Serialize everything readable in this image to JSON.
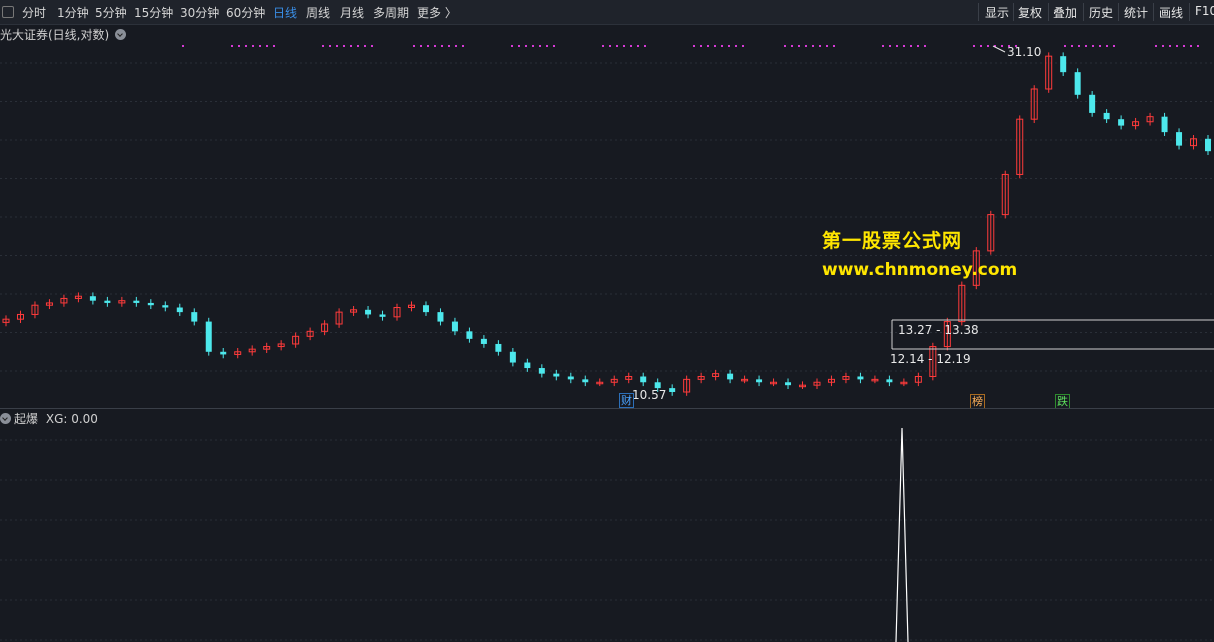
{
  "toolbar": {
    "tabs": [
      "分时",
      "1分钟",
      "5分钟",
      "15分钟",
      "30分钟",
      "60分钟",
      "日线",
      "周线",
      "月线",
      "多周期",
      "更多 〉"
    ],
    "active_tab": "日线",
    "right_buttons": [
      "显示",
      "复权",
      "叠加",
      "历史",
      "统计",
      "画线",
      "F10"
    ]
  },
  "chart": {
    "title": "光大证券(日线,对数)",
    "price_labels": {
      "high": "31.10",
      "low": "10.57",
      "range_upper": "13.27 - 13.38",
      "range_lower": "12.14 - 12.19"
    },
    "tags": {
      "cai": "财",
      "bang": "榜",
      "die": "跌"
    },
    "colors": {
      "up": "#ff3b3b",
      "down": "#4de8ec",
      "marker": "#d63ad6",
      "bg": "#171a21"
    }
  },
  "indicator": {
    "name": "起爆",
    "value_text": "XG: 0.00"
  },
  "watermark": {
    "line1": "第一股票公式网",
    "line2": "www.chnmoney.com"
  },
  "chart_data": {
    "type": "candlestick",
    "title": "光大证券(日线,对数)",
    "high_label": 31.1,
    "low_label": 10.57,
    "close_approx": [
      13.3,
      13.5,
      13.9,
      14.0,
      14.2,
      14.3,
      14.1,
      14.0,
      14.1,
      14.0,
      13.9,
      13.8,
      13.6,
      13.2,
      12.0,
      11.9,
      12.0,
      12.1,
      12.2,
      12.3,
      12.6,
      12.8,
      13.1,
      13.6,
      13.7,
      13.5,
      13.4,
      13.8,
      13.9,
      13.6,
      13.2,
      12.8,
      12.5,
      12.3,
      12.0,
      11.6,
      11.4,
      11.2,
      11.1,
      11.0,
      10.9,
      10.9,
      11.0,
      11.1,
      10.9,
      10.7,
      10.57,
      11.0,
      11.1,
      11.2,
      11.0,
      11.0,
      10.9,
      10.9,
      10.8,
      10.8,
      10.9,
      11.0,
      11.1,
      11.0,
      11.0,
      10.9,
      10.9,
      11.1,
      12.2,
      13.2,
      14.8,
      16.5,
      18.5,
      21.0,
      25.0,
      27.5,
      30.5,
      29.0,
      27.0,
      25.5,
      25.0,
      24.5,
      24.8,
      25.2,
      24.0,
      23.0,
      23.5,
      22.6
    ],
    "indicator": {
      "name": "XG",
      "value": 0.0,
      "spike_at_bar": "breakout"
    }
  }
}
